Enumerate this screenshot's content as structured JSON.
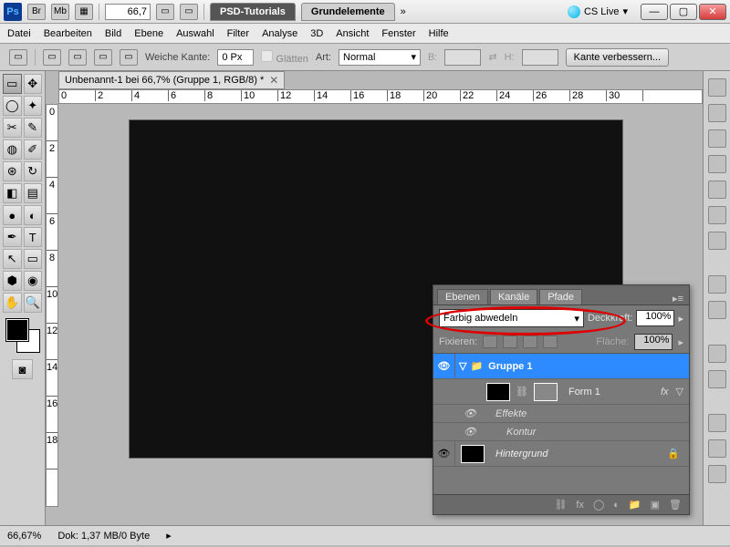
{
  "titlebar": {
    "zoom": "66,7",
    "tab1": "PSD-Tutorials",
    "tab2": "Grundelemente",
    "cslive": "CS Live"
  },
  "menu": [
    "Datei",
    "Bearbeiten",
    "Bild",
    "Ebene",
    "Auswahl",
    "Filter",
    "Analyse",
    "3D",
    "Ansicht",
    "Fenster",
    "Hilfe"
  ],
  "options": {
    "weiche": "Weiche Kante:",
    "weiche_val": "0 Px",
    "glatten": "Glätten",
    "art": "Art:",
    "art_val": "Normal",
    "b": "B:",
    "h": "H:",
    "improve": "Kante verbessern..."
  },
  "doc": {
    "tab": "Unbenannt-1 bei 66,7% (Gruppe 1, RGB/8) *"
  },
  "ruler_h": [
    "0",
    "2",
    "4",
    "6",
    "8",
    "10",
    "12",
    "14",
    "16",
    "18",
    "20",
    "22",
    "24",
    "26",
    "28",
    "30"
  ],
  "ruler_v": [
    "0",
    "2",
    "4",
    "6",
    "8",
    "10",
    "12",
    "14",
    "16",
    "18"
  ],
  "layers": {
    "tabs": [
      "Ebenen",
      "Kanäle",
      "Pfade"
    ],
    "blend": "Farbig abwedeln",
    "deck": "Deckkraft:",
    "deck_val": "100%",
    "fix": "Fixieren:",
    "flache": "Fläche:",
    "flache_val": "100%",
    "group": "Gruppe 1",
    "form": "Form 1",
    "effekte": "Effekte",
    "kontur": "Kontur",
    "hintergrund": "Hintergrund",
    "fx": "fx"
  },
  "status": {
    "zoom": "66,67%",
    "dok": "Dok: 1,37 MB/0 Byte"
  }
}
